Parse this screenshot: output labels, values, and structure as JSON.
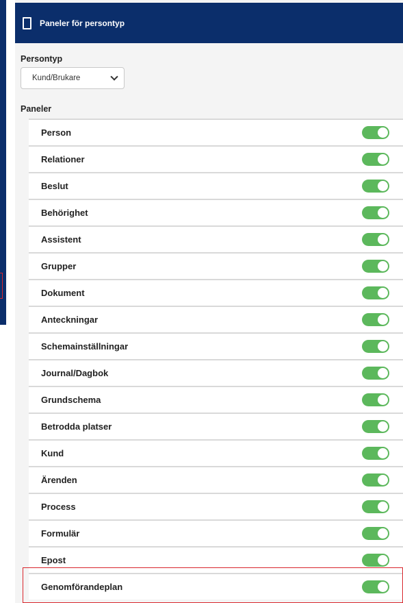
{
  "header": {
    "title": "Paneler för persontyp",
    "icon": "mobile-device-icon"
  },
  "persontyp": {
    "label": "Persontyp",
    "selected": "Kund/Brukare"
  },
  "paneler": {
    "label": "Paneler",
    "items": [
      {
        "label": "Person",
        "enabled": true
      },
      {
        "label": "Relationer",
        "enabled": true
      },
      {
        "label": "Beslut",
        "enabled": true
      },
      {
        "label": "Behörighet",
        "enabled": true
      },
      {
        "label": "Assistent",
        "enabled": true
      },
      {
        "label": "Grupper",
        "enabled": true
      },
      {
        "label": "Dokument",
        "enabled": true
      },
      {
        "label": "Anteckningar",
        "enabled": true
      },
      {
        "label": "Schemainställningar",
        "enabled": true
      },
      {
        "label": "Journal/Dagbok",
        "enabled": true
      },
      {
        "label": "Grundschema",
        "enabled": true
      },
      {
        "label": "Betrodda platser",
        "enabled": true
      },
      {
        "label": "Kund",
        "enabled": true
      },
      {
        "label": "Ärenden",
        "enabled": true
      },
      {
        "label": "Process",
        "enabled": true
      },
      {
        "label": "Formulär",
        "enabled": true
      },
      {
        "label": "Epost",
        "enabled": true
      },
      {
        "label": "Genomförandeplan",
        "enabled": true
      }
    ]
  },
  "colors": {
    "header": "#0b2e6b",
    "toggle_on": "#5cb85c",
    "highlight": "#d9262c"
  }
}
